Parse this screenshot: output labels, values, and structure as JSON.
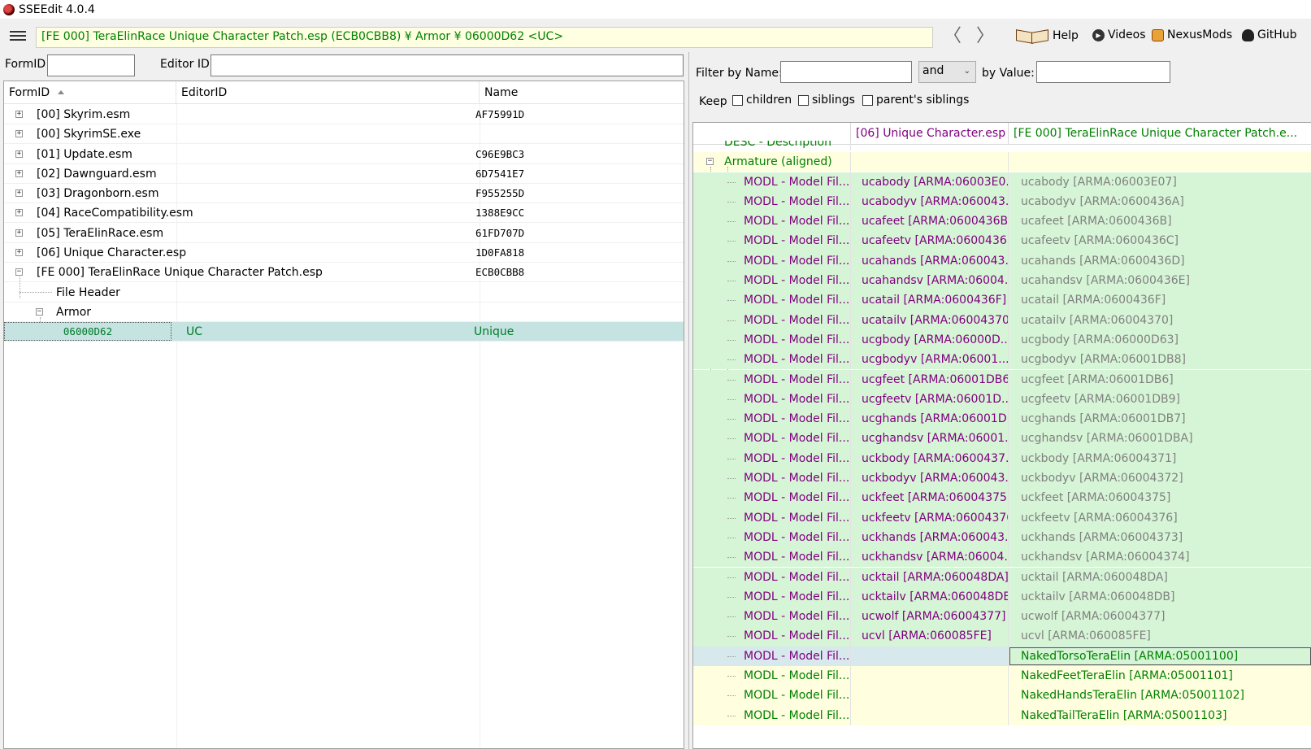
{
  "window": {
    "title": "SSEEdit 4.0.4"
  },
  "toolbar": {
    "path": "[FE 000] TeraElinRace Unique Character Patch.esp (ECB0CBB8) ¥ Armor ¥ 06000D62 <UC>",
    "back_glyph": "〈",
    "forward_glyph": "〉",
    "help": "Help",
    "videos": "Videos",
    "nexusmods": "NexusMods",
    "github": "GitHub"
  },
  "left_search": {
    "formid_label": "FormID",
    "editorid_label": "Editor ID",
    "formid_value": "",
    "editorid_value": ""
  },
  "tree": {
    "columns": [
      "FormID",
      "EditorID",
      "Name"
    ],
    "rows": [
      {
        "expander": "+",
        "label": "[00] Skyrim.esm",
        "code": "AF75991D"
      },
      {
        "expander": "+",
        "label": "[00] SkyrimSE.exe",
        "code": ""
      },
      {
        "expander": "+",
        "label": "[01] Update.esm",
        "code": "C96E9BC3"
      },
      {
        "expander": "+",
        "label": "[02] Dawnguard.esm",
        "code": "6D7541E7"
      },
      {
        "expander": "+",
        "label": "[03] Dragonborn.esm",
        "code": "F955255D"
      },
      {
        "expander": "+",
        "label": "[04] RaceCompatibility.esm",
        "code": "1388E9CC"
      },
      {
        "expander": "+",
        "label": "[05] TeraElinRace.esm",
        "code": "61FD707D"
      },
      {
        "expander": "+",
        "label": "[06] Unique Character.esp",
        "code": "1D0FA818"
      },
      {
        "expander": "−",
        "label": "[FE 000] TeraElinRace Unique Character Patch.esp",
        "code": "ECB0CBB8"
      }
    ],
    "file_header": "File Header",
    "armor_group": "Armor",
    "armor_expander": "−",
    "selected": {
      "formid": "06000D62",
      "editorid": "UC",
      "name": "Unique"
    }
  },
  "filter": {
    "by_name_label": "Filter by Name:",
    "name_value": "",
    "operator": "and",
    "by_value_label": "by Value:",
    "value_value": "",
    "keep_label": "Keep",
    "children_label": "children",
    "siblings_label": "siblings",
    "parents_siblings_label": "parent's siblings"
  },
  "grid": {
    "columns": [
      "",
      "[06] Unique Character.esp",
      "[FE 000] TeraElinRace Unique Character Patch.e..."
    ],
    "partial_row": "DESC - Description",
    "group_label": "Armature (aligned)",
    "group_expander": "−",
    "row_label": "MODL - Model Fil...",
    "rows": [
      {
        "a": "ucabody [ARMA:06003E0...",
        "b": "ucabody [ARMA:06003E07]",
        "style": "green"
      },
      {
        "a": "ucabodyv [ARMA:060043...",
        "b": "ucabodyv [ARMA:0600436A]",
        "style": "green"
      },
      {
        "a": "ucafeet [ARMA:0600436B]",
        "b": "ucafeet [ARMA:0600436B]",
        "style": "green"
      },
      {
        "a": "ucafeetv [ARMA:0600436...",
        "b": "ucafeetv [ARMA:0600436C]",
        "style": "green"
      },
      {
        "a": "ucahands [ARMA:060043...",
        "b": "ucahands [ARMA:0600436D]",
        "style": "green"
      },
      {
        "a": "ucahandsv [ARMA:06004...",
        "b": "ucahandsv [ARMA:0600436E]",
        "style": "green"
      },
      {
        "a": "ucatail [ARMA:0600436F]",
        "b": "ucatail [ARMA:0600436F]",
        "style": "green"
      },
      {
        "a": "ucatailv [ARMA:06004370]",
        "b": "ucatailv [ARMA:06004370]",
        "style": "green"
      },
      {
        "a": "ucgbody [ARMA:06000D...",
        "b": "ucgbody [ARMA:06000D63]",
        "style": "green"
      },
      {
        "a": "ucgbodyv [ARMA:06001...",
        "b": "ucgbodyv [ARMA:06001DB8]",
        "style": "green"
      },
      {
        "a": "ucgfeet [ARMA:06001DB6]",
        "b": "ucgfeet [ARMA:06001DB6]",
        "style": "green"
      },
      {
        "a": "ucgfeetv [ARMA:06001D...",
        "b": "ucgfeetv [ARMA:06001DB9]",
        "style": "green"
      },
      {
        "a": "ucghands [ARMA:06001D...",
        "b": "ucghands [ARMA:06001DB7]",
        "style": "green"
      },
      {
        "a": "ucghandsv [ARMA:06001...",
        "b": "ucghandsv [ARMA:06001DBA]",
        "style": "green"
      },
      {
        "a": "uckbody [ARMA:0600437...",
        "b": "uckbody [ARMA:06004371]",
        "style": "green"
      },
      {
        "a": "uckbodyv [ARMA:060043...",
        "b": "uckbodyv [ARMA:06004372]",
        "style": "green"
      },
      {
        "a": "uckfeet [ARMA:06004375]",
        "b": "uckfeet [ARMA:06004375]",
        "style": "green"
      },
      {
        "a": "uckfeetv [ARMA:06004376]",
        "b": "uckfeetv [ARMA:06004376]",
        "style": "green"
      },
      {
        "a": "uckhands [ARMA:060043...",
        "b": "uckhands [ARMA:06004373]",
        "style": "green"
      },
      {
        "a": "uckhandsv [ARMA:06004...",
        "b": "uckhandsv [ARMA:06004374]",
        "style": "green"
      },
      {
        "a": "ucktail [ARMA:060048DA]",
        "b": "ucktail [ARMA:060048DA]",
        "style": "green"
      },
      {
        "a": "ucktailv [ARMA:060048DB]",
        "b": "ucktailv [ARMA:060048DB]",
        "style": "green"
      },
      {
        "a": "ucwolf [ARMA:06004377]",
        "b": "ucwolf [ARMA:06004377]",
        "style": "green"
      },
      {
        "a": "ucvl [ARMA:060085FE]",
        "b": "ucvl [ARMA:060085FE]",
        "style": "green"
      },
      {
        "a": "",
        "b": "NakedTorsoTeraElin [ARMA:05001100]",
        "style": "selrow"
      },
      {
        "a": "",
        "b": "NakedFeetTeraElin [ARMA:05001101]",
        "style": "yellow"
      },
      {
        "a": "",
        "b": "NakedHandsTeraElin [ARMA:05001102]",
        "style": "yellow"
      },
      {
        "a": "",
        "b": "NakedTailTeraElin [ARMA:05001103]",
        "style": "yellow"
      }
    ]
  },
  "colors": {
    "green_row": "#d6f5d6",
    "yellow_row": "#ffffe0",
    "purple_text": "#800080",
    "green_text": "#008000",
    "selection": "#c5e3e0"
  }
}
